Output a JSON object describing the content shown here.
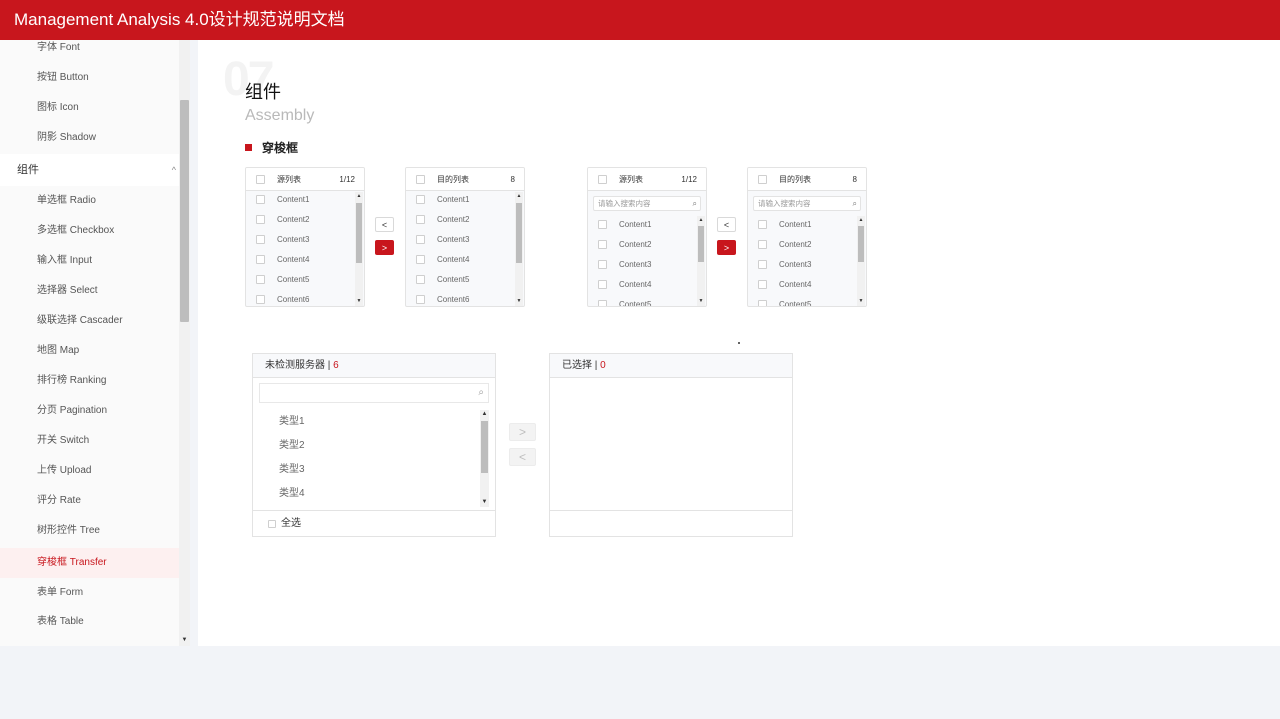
{
  "app": {
    "title": "Management Analysis 4.0设计规范说明文档"
  },
  "sidebar": {
    "items_before": [
      "字体 Font",
      "按钮 Button",
      "图标 Icon",
      "阴影 Shadow"
    ],
    "group": {
      "label": "组件",
      "chevron": "^"
    },
    "items": [
      "单选框 Radio",
      "多选框 Checkbox",
      "输入框 Input",
      "选择器 Select",
      "级联选择 Cascader",
      "地图  Map",
      "排行榜  Ranking",
      "分页 Pagination",
      "开关 Switch",
      "上传 Upload",
      "评分 Rate",
      "树形控件 Tree",
      "穿梭框 Transfer",
      "表单 Form",
      "表格 Table"
    ],
    "active_item": "穿梭框 Transfer",
    "accent_color": "#c8161d"
  },
  "section": {
    "number": "07",
    "title": "组件",
    "subtitle": "Assembly",
    "subheading": "穿梭框"
  },
  "transfer1": {
    "source": {
      "label": "源列表",
      "count": "1/12",
      "items": [
        "Content1",
        "Content2",
        "Content3",
        "Content4",
        "Content5",
        "Content6"
      ]
    },
    "target": {
      "label": "目的列表",
      "count": "8",
      "items": [
        "Content1",
        "Content2",
        "Content3",
        "Content4",
        "Content5",
        "Content6"
      ]
    },
    "btn_left": "<",
    "btn_right": ">"
  },
  "transfer2": {
    "source": {
      "label": "源列表",
      "count": "1/12",
      "search_placeholder": "请输入搜索内容",
      "items": [
        "Content1",
        "Content2",
        "Content3",
        "Content4",
        "Content5"
      ]
    },
    "target": {
      "label": "目的列表",
      "count": "8",
      "search_placeholder": "请输入搜索内容",
      "items": [
        "Content1",
        "Content2",
        "Content3",
        "Content4",
        "Content5"
      ]
    },
    "btn_left": "<",
    "btn_right": ">"
  },
  "transfer3": {
    "left": {
      "title": "未检测服务器",
      "sep": " | ",
      "count": "6",
      "items": [
        "类型1",
        "类型2",
        "类型3",
        "类型4"
      ],
      "select_all": "全选"
    },
    "right": {
      "title": "已选择",
      "sep": " | ",
      "count": "0"
    },
    "btn_right": ">",
    "btn_left": "<"
  },
  "icons": {
    "search": "⌕",
    "scroll_up": "▲",
    "scroll_down": "▼"
  }
}
